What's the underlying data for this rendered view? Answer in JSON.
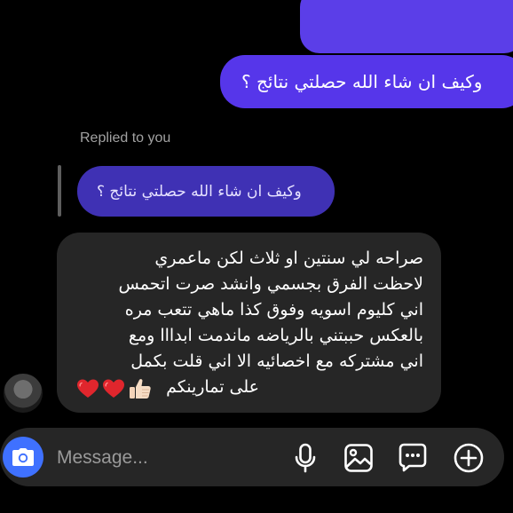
{
  "thread": {
    "sent_message": "وكيف ان شاء الله حصلتي نتائج ؟",
    "replied_label": "Replied to you",
    "quoted_message": "وكيف ان شاء الله حصلتي نتائج ؟",
    "received_lines": [
      "صراحه لي سنتين او ثلاث لكن ماعمري",
      "لاحظت الفرق بجسمي وانشد صرت اتحمس",
      "اني كليوم اسويه وفوق كذا ماهي تتعب مره",
      "بالعكس حببتني بالرياضه ماندمت ابدااا ومع",
      "اني مشتركه مع اخصائيه الا اني قلت بكمل"
    ],
    "received_last_line": "على تمارينكم",
    "received_emojis": [
      "thumbs-up",
      "red-heart",
      "red-heart"
    ]
  },
  "composer": {
    "placeholder": "Message..."
  },
  "icons": {
    "camera": "camera-icon",
    "mic": "microphone-icon",
    "gallery": "image-icon",
    "sticker": "sticker-chat-icon",
    "plus": "plus-circle-icon"
  },
  "colors": {
    "sent_bubble": "#5636ea",
    "quoted_bubble": "#3f31b4",
    "received_bubble": "#262626",
    "camera_button": "#3f71ff",
    "heart": "#e0262d"
  }
}
